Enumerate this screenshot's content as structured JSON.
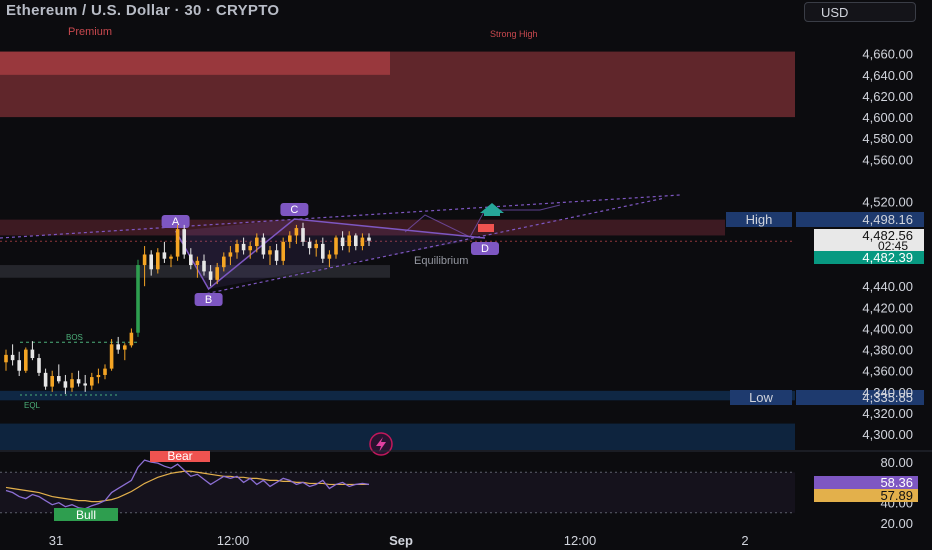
{
  "header": {
    "symbol_title": "Ethereum / U.S. Dollar · 30 · CRYPTO",
    "currency_button": "USD"
  },
  "colors": {
    "background": "#0c0c0f",
    "up": "#f5a524",
    "down": "#e6e6e6",
    "premium_zone": "#c8484e",
    "pattern": "#7e57c2",
    "demand_zone": "#0f2a4a",
    "high_label": "#1e3a6e",
    "rsi_line": "#8c6fd4",
    "rsi_ma": "#e3b04b",
    "last_price": "#089981"
  },
  "chart_data": {
    "type": "candlestick",
    "symbol": "Ethereum / U.S. Dollar",
    "interval": "30",
    "exchange": "CRYPTO",
    "y_ticks": [
      4660,
      4640,
      4620,
      4600,
      4580,
      4560,
      4520,
      4440,
      4420,
      4400,
      4380,
      4360,
      4340,
      4320,
      4300
    ],
    "ylim": [
      4285,
      4690
    ],
    "x_ticks": [
      "31",
      "12:00",
      "Sep",
      "12:00",
      "2"
    ],
    "candles": [
      [
        4368,
        4380,
        4360,
        4375
      ],
      [
        4375,
        4385,
        4365,
        4370
      ],
      [
        4370,
        4378,
        4355,
        4360
      ],
      [
        4360,
        4382,
        4358,
        4380
      ],
      [
        4380,
        4388,
        4370,
        4372
      ],
      [
        4372,
        4376,
        4355,
        4358
      ],
      [
        4358,
        4362,
        4342,
        4345
      ],
      [
        4345,
        4360,
        4340,
        4355
      ],
      [
        4355,
        4366,
        4348,
        4350
      ],
      [
        4350,
        4356,
        4338,
        4344
      ],
      [
        4344,
        4358,
        4340,
        4352
      ],
      [
        4352,
        4360,
        4345,
        4348
      ],
      [
        4348,
        4356,
        4340,
        4346
      ],
      [
        4346,
        4358,
        4342,
        4354
      ],
      [
        4354,
        4362,
        4348,
        4356
      ],
      [
        4356,
        4366,
        4352,
        4362
      ],
      [
        4362,
        4390,
        4360,
        4385
      ],
      [
        4385,
        4392,
        4376,
        4380
      ],
      [
        4380,
        4386,
        4370,
        4384
      ],
      [
        4384,
        4400,
        4382,
        4396
      ],
      [
        4396,
        4465,
        4392,
        4460
      ],
      [
        4460,
        4478,
        4440,
        4470
      ],
      [
        4470,
        4474,
        4450,
        4456
      ],
      [
        4456,
        4476,
        4452,
        4472
      ],
      [
        4472,
        4482,
        4462,
        4466
      ],
      [
        4466,
        4470,
        4458,
        4468
      ],
      [
        4468,
        4498,
        4464,
        4494
      ],
      [
        4494,
        4498,
        4466,
        4470
      ],
      [
        4470,
        4476,
        4456,
        4460
      ],
      [
        4460,
        4468,
        4448,
        4464
      ],
      [
        4464,
        4470,
        4450,
        4454
      ],
      [
        4454,
        4460,
        4440,
        4446
      ],
      [
        4446,
        4462,
        4442,
        4458
      ],
      [
        4458,
        4472,
        4454,
        4468
      ],
      [
        4468,
        4478,
        4460,
        4472
      ],
      [
        4472,
        4484,
        4466,
        4480
      ],
      [
        4480,
        4486,
        4470,
        4474
      ],
      [
        4474,
        4482,
        4466,
        4478
      ],
      [
        4478,
        4490,
        4472,
        4486
      ],
      [
        4486,
        4490,
        4466,
        4470
      ],
      [
        4470,
        4478,
        4460,
        4474
      ],
      [
        4474,
        4480,
        4460,
        4464
      ],
      [
        4464,
        4486,
        4460,
        4482
      ],
      [
        4482,
        4492,
        4476,
        4488
      ],
      [
        4488,
        4498,
        4480,
        4495
      ],
      [
        4495,
        4500,
        4478,
        4482
      ],
      [
        4482,
        4486,
        4470,
        4476
      ],
      [
        4476,
        4484,
        4468,
        4480
      ],
      [
        4480,
        4486,
        4462,
        4466
      ],
      [
        4466,
        4474,
        4458,
        4470
      ],
      [
        4470,
        4488,
        4466,
        4486
      ],
      [
        4486,
        4492,
        4474,
        4478
      ],
      [
        4478,
        4492,
        4472,
        4488
      ],
      [
        4488,
        4490,
        4474,
        4478
      ],
      [
        4478,
        4490,
        4474,
        4486
      ],
      [
        4486,
        4490,
        4478,
        4483
      ]
    ],
    "price_labels": [
      {
        "name": "High",
        "value": "4,498.16"
      },
      {
        "name": "",
        "value": "4,482.56",
        "countdown": "02:45"
      },
      {
        "name": "",
        "value": "4,482.39"
      },
      {
        "name": "Low",
        "value": "4,335.85"
      }
    ],
    "zones": [
      {
        "label": "Premium",
        "from": 4600,
        "to": 4662
      },
      {
        "label": "Strong High",
        "from": 4600,
        "to": 4662
      },
      {
        "label": "Equilibrium",
        "from": 4475,
        "to": 4500
      }
    ],
    "annotations": [
      {
        "text": "A",
        "x_index": 26,
        "y": 4498
      },
      {
        "text": "B",
        "x_index": 31,
        "y": 4440
      },
      {
        "text": "C",
        "x_index": 44,
        "y": 4500
      },
      {
        "text": "D",
        "x_index": 66,
        "y": 4480
      },
      {
        "text": "BOS",
        "y": 4387
      },
      {
        "text": "EQL",
        "y": 4338
      }
    ],
    "rsi": {
      "ylim": [
        15,
        90
      ],
      "y_ticks": [
        80,
        40,
        20
      ],
      "rsi_value": "58.36",
      "ma_value": "57.89",
      "labels": [
        "Bear",
        "Bull"
      ],
      "rsi_values": [
        52,
        50,
        46,
        44,
        48,
        46,
        42,
        38,
        40,
        36,
        38,
        35,
        34,
        37,
        39,
        42,
        50,
        54,
        58,
        62,
        75,
        82,
        80,
        79,
        76,
        74,
        78,
        72,
        66,
        68,
        63,
        58,
        62,
        66,
        64,
        66,
        60,
        64,
        58,
        62,
        56,
        60,
        64,
        62,
        58,
        60,
        56,
        58,
        62,
        54,
        58,
        60,
        56,
        58,
        59,
        58
      ],
      "ma_values": [
        55,
        54,
        53,
        52,
        51,
        50,
        48,
        46,
        45,
        44,
        43,
        42,
        42,
        41,
        41,
        42,
        43,
        45,
        48,
        51,
        55,
        59,
        62,
        65,
        67,
        69,
        70,
        71,
        71,
        70,
        69,
        68,
        67,
        66,
        66,
        65,
        65,
        64,
        64,
        63,
        62,
        62,
        61,
        61,
        60,
        60,
        59,
        59,
        59,
        58,
        58,
        58,
        58,
        58,
        58,
        58
      ]
    }
  }
}
